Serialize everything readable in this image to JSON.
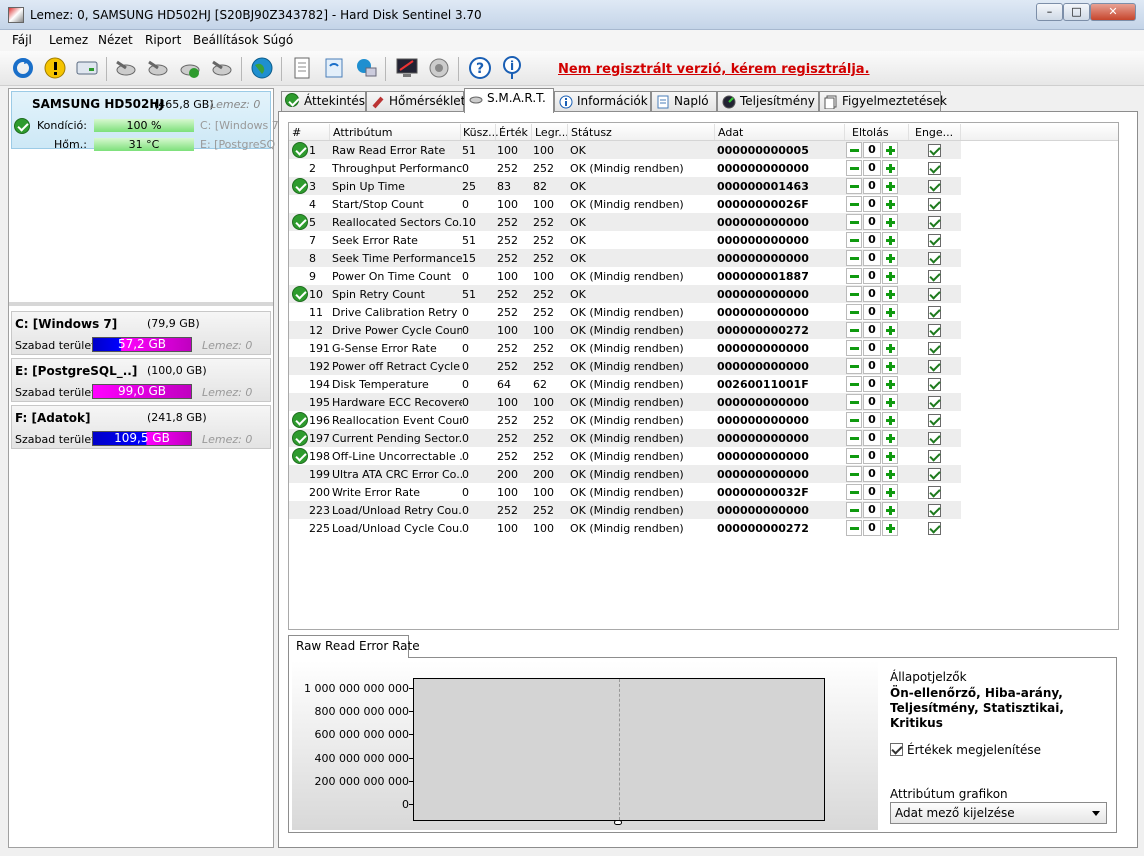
{
  "window": {
    "title": "Lemez: 0, SAMSUNG HD502HJ [S20BJ90Z343782]  -  Hard Disk Sentinel 3.70"
  },
  "menu": [
    "Fájl",
    "Lemez",
    "Nézet",
    "Riport",
    "Beállítások",
    "Súgó"
  ],
  "toolbar": {
    "registration_text": "Nem regisztrált verzió, kérem regisztrálja."
  },
  "disk": {
    "name": "SAMSUNG HD502HJ",
    "size": "(465,8 GB)",
    "lemez": "Lemez: 0",
    "condition_label": "Kondíció:",
    "condition_value": "100 %",
    "condition_percent": 100,
    "temp_label": "Hőm.:",
    "temp_value": "31 °C",
    "partition_hint_1": "C: [Windows 7",
    "partition_hint_2": "E: [PostgreSQ"
  },
  "partitions": [
    {
      "name": "C: [Windows 7]",
      "size": "(79,9 GB)",
      "free_label": "Szabad terület",
      "free": "57,2 GB",
      "lemez": "Lemez: 0"
    },
    {
      "name": "E: [PostgreSQL_..]",
      "size": "(100,0 GB)",
      "free_label": "Szabad terület",
      "free": "99,0 GB",
      "lemez": "Lemez: 0"
    },
    {
      "name": "F: [Adatok]",
      "size": "(241,8 GB)",
      "free_label": "Szabad terület",
      "free": "109,5 GB",
      "lemez": "Lemez: 0"
    }
  ],
  "tabs": [
    "Áttekintés",
    "Hőmérséklet",
    "S.M.A.R.T.",
    "Információk",
    "Napló",
    "Teljesítmény",
    "Figyelmeztetések"
  ],
  "active_tab": "S.M.A.R.T.",
  "smart": {
    "headers": [
      "#",
      "Attribútum",
      "Küsz...",
      "Érték",
      "Legr...",
      "Státusz",
      "Adat",
      "Eltolás",
      "Enge..."
    ],
    "rows": [
      {
        "id": "1",
        "name": "Raw Read Error Rate",
        "thr": "51",
        "val": "100",
        "worst": "100",
        "status": "OK",
        "data": "000000000005",
        "ok": true,
        "offset": "0"
      },
      {
        "id": "2",
        "name": "Throughput Performance",
        "thr": "0",
        "val": "252",
        "worst": "252",
        "status": "OK (Mindig rendben)",
        "data": "000000000000",
        "ok": false,
        "offset": "0"
      },
      {
        "id": "3",
        "name": "Spin Up Time",
        "thr": "25",
        "val": "83",
        "worst": "82",
        "status": "OK",
        "data": "000000001463",
        "ok": true,
        "offset": "0"
      },
      {
        "id": "4",
        "name": "Start/Stop Count",
        "thr": "0",
        "val": "100",
        "worst": "100",
        "status": "OK (Mindig rendben)",
        "data": "00000000026F",
        "ok": false,
        "offset": "0"
      },
      {
        "id": "5",
        "name": "Reallocated Sectors Co...",
        "thr": "10",
        "val": "252",
        "worst": "252",
        "status": "OK",
        "data": "000000000000",
        "ok": true,
        "offset": "0"
      },
      {
        "id": "7",
        "name": "Seek Error Rate",
        "thr": "51",
        "val": "252",
        "worst": "252",
        "status": "OK",
        "data": "000000000000",
        "ok": false,
        "offset": "0"
      },
      {
        "id": "8",
        "name": "Seek Time Performance",
        "thr": "15",
        "val": "252",
        "worst": "252",
        "status": "OK",
        "data": "000000000000",
        "ok": false,
        "offset": "0"
      },
      {
        "id": "9",
        "name": "Power On Time Count",
        "thr": "0",
        "val": "100",
        "worst": "100",
        "status": "OK (Mindig rendben)",
        "data": "000000001887",
        "ok": false,
        "offset": "0"
      },
      {
        "id": "10",
        "name": "Spin Retry Count",
        "thr": "51",
        "val": "252",
        "worst": "252",
        "status": "OK",
        "data": "000000000000",
        "ok": true,
        "offset": "0"
      },
      {
        "id": "11",
        "name": "Drive Calibration Retry ...",
        "thr": "0",
        "val": "252",
        "worst": "252",
        "status": "OK (Mindig rendben)",
        "data": "000000000000",
        "ok": false,
        "offset": "0"
      },
      {
        "id": "12",
        "name": "Drive Power Cycle Count",
        "thr": "0",
        "val": "100",
        "worst": "100",
        "status": "OK (Mindig rendben)",
        "data": "000000000272",
        "ok": false,
        "offset": "0"
      },
      {
        "id": "191",
        "name": "G-Sense Error Rate",
        "thr": "0",
        "val": "252",
        "worst": "252",
        "status": "OK (Mindig rendben)",
        "data": "000000000000",
        "ok": false,
        "offset": "0"
      },
      {
        "id": "192",
        "name": "Power off Retract Cycle ...",
        "thr": "0",
        "val": "252",
        "worst": "252",
        "status": "OK (Mindig rendben)",
        "data": "000000000000",
        "ok": false,
        "offset": "0"
      },
      {
        "id": "194",
        "name": "Disk Temperature",
        "thr": "0",
        "val": "64",
        "worst": "62",
        "status": "OK (Mindig rendben)",
        "data": "00260011001F",
        "ok": false,
        "offset": "0"
      },
      {
        "id": "195",
        "name": "Hardware ECC Recovered",
        "thr": "0",
        "val": "100",
        "worst": "100",
        "status": "OK (Mindig rendben)",
        "data": "000000000000",
        "ok": false,
        "offset": "0"
      },
      {
        "id": "196",
        "name": "Reallocation Event Count",
        "thr": "0",
        "val": "252",
        "worst": "252",
        "status": "OK (Mindig rendben)",
        "data": "000000000000",
        "ok": true,
        "offset": "0"
      },
      {
        "id": "197",
        "name": "Current Pending Sector...",
        "thr": "0",
        "val": "252",
        "worst": "252",
        "status": "OK (Mindig rendben)",
        "data": "000000000000",
        "ok": true,
        "offset": "0"
      },
      {
        "id": "198",
        "name": "Off-Line Uncorrectable ...",
        "thr": "0",
        "val": "252",
        "worst": "252",
        "status": "OK (Mindig rendben)",
        "data": "000000000000",
        "ok": true,
        "offset": "0"
      },
      {
        "id": "199",
        "name": "Ultra ATA CRC Error Co...",
        "thr": "0",
        "val": "200",
        "worst": "200",
        "status": "OK (Mindig rendben)",
        "data": "000000000000",
        "ok": false,
        "offset": "0"
      },
      {
        "id": "200",
        "name": "Write Error Rate",
        "thr": "0",
        "val": "100",
        "worst": "100",
        "status": "OK (Mindig rendben)",
        "data": "00000000032F",
        "ok": false,
        "offset": "0"
      },
      {
        "id": "223",
        "name": "Load/Unload Retry Cou...",
        "thr": "0",
        "val": "252",
        "worst": "252",
        "status": "OK (Mindig rendben)",
        "data": "000000000000",
        "ok": false,
        "offset": "0"
      },
      {
        "id": "225",
        "name": "Load/Unload Cycle Cou...",
        "thr": "0",
        "val": "100",
        "worst": "100",
        "status": "OK (Mindig rendben)",
        "data": "000000000272",
        "ok": false,
        "offset": "0"
      }
    ]
  },
  "graph": {
    "tab_label": "Raw Read Error Rate",
    "yticks": [
      "1 000 000 000 000",
      "800 000 000 000",
      "600 000 000 000",
      "400 000 000 000",
      "200 000 000 000",
      "0"
    ]
  },
  "side": {
    "indicator_title": "Állapotjelzők",
    "indicator_text": "Ön-ellenőrző, Hiba-arány, Teljesítmény, Statisztikai, Kritikus",
    "show_values_label": "Értékek megjelenítése",
    "graph_label": "Attribútum grafikon",
    "graph_select": "Adat mező kijelzése"
  }
}
